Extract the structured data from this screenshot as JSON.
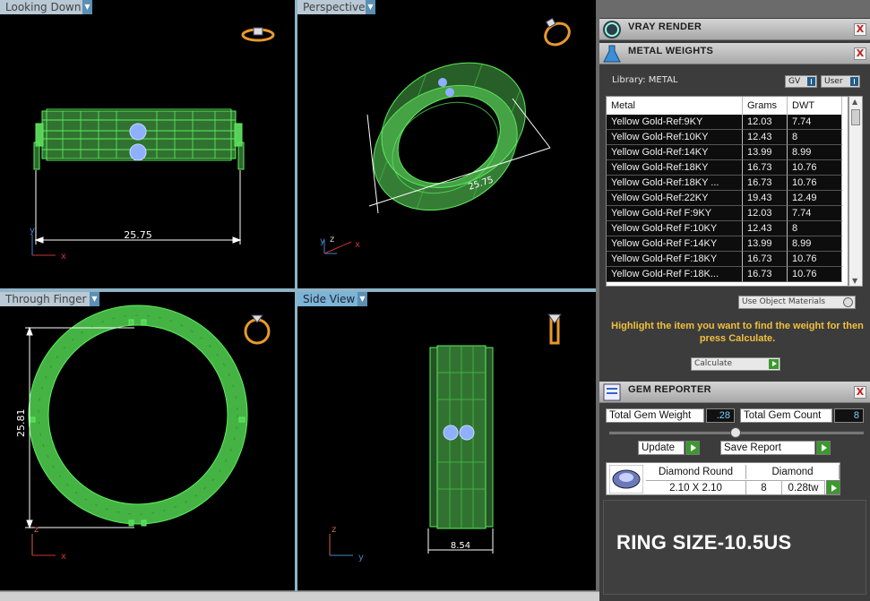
{
  "viewports": {
    "top": {
      "label": "Looking Down",
      "dimension": "25.75"
    },
    "persp": {
      "label": "Perspective",
      "dimension": "25.75"
    },
    "front": {
      "label": "Through Finger",
      "dimension": "25.81"
    },
    "side": {
      "label": "Side View",
      "dimension": "8.54"
    },
    "axes": {
      "x": "x",
      "y": "y",
      "z": "z"
    }
  },
  "rollouts": {
    "vray": {
      "title": "VRAY RENDER",
      "close": "X"
    },
    "metal": {
      "title": "METAL WEIGHTS",
      "close": "X"
    },
    "gem": {
      "title": "GEM REPORTER",
      "close": "X"
    }
  },
  "metal_weights": {
    "library_label": "Library: METAL",
    "toggle_gv": "GV",
    "toggle_user": "User",
    "columns": [
      "Metal",
      "Grams",
      "DWT"
    ],
    "rows": [
      [
        "Yellow Gold-Ref:9KY",
        "12.03",
        "7.74"
      ],
      [
        "Yellow Gold-Ref:10KY",
        "12.43",
        "8"
      ],
      [
        "Yellow Gold-Ref:14KY",
        "13.99",
        "8.99"
      ],
      [
        "Yellow Gold-Ref:18KY",
        "16.73",
        "10.76"
      ],
      [
        "Yellow Gold-Ref:18KY ...",
        "16.73",
        "10.76"
      ],
      [
        "Yellow Gold-Ref:22KY",
        "19.43",
        "12.49"
      ],
      [
        "Yellow Gold-Ref F:9KY",
        "12.03",
        "7.74"
      ],
      [
        "Yellow Gold-Ref F:10KY",
        "12.43",
        "8"
      ],
      [
        "Yellow Gold-Ref F:14KY",
        "13.99",
        "8.99"
      ],
      [
        "Yellow Gold-Ref F:18KY",
        "16.73",
        "10.76"
      ],
      [
        "Yellow Gold-Ref F:18K...",
        "16.73",
        "10.76"
      ]
    ],
    "use_object_materials": "Use Object Materials",
    "hint": "Highlight the item you want to find the weight for then press Calculate.",
    "calculate_label": "Calculate"
  },
  "gem_reporter": {
    "total_weight_label": "Total Gem Weight",
    "total_weight_value": ".28",
    "total_count_label": "Total Gem Count",
    "total_count_value": "8",
    "update_label": "Update",
    "save_report_label": "Save Report",
    "gem": {
      "name": "Diamond Round",
      "size": "2.10 X 2.10",
      "material": "Diamond",
      "count": "8",
      "weight": "0.28tw"
    }
  },
  "overlay_text": "RING SIZE-10.5US",
  "colors": {
    "wire": "#66ff66",
    "gem": "#8fb0ff",
    "hint": "#f0c03c",
    "go": "#3a9a2c"
  }
}
